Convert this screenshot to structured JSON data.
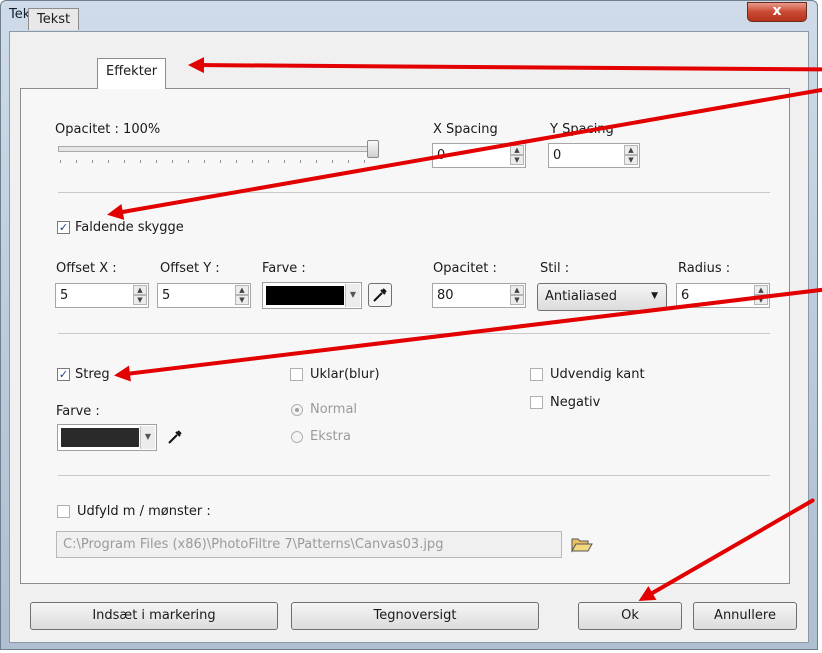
{
  "window": {
    "title": "Tekst",
    "close_label": "x"
  },
  "tabs": [
    {
      "label": "Tekst"
    },
    {
      "label": "Effekter"
    }
  ],
  "opacity": {
    "label": "Opacitet : 100%"
  },
  "spacing": {
    "x_label": "X Spacing",
    "x_value": "0",
    "y_label": "Y Spacing",
    "y_value": "0"
  },
  "shadow": {
    "check_label": "Faldende skygge",
    "offset_x_label": "Offset X :",
    "offset_x_value": "5",
    "offset_y_label": "Offset Y :",
    "offset_y_value": "5",
    "color_label": "Farve :",
    "opacity_label": "Opacitet :",
    "opacity_value": "80",
    "style_label": "Stil :",
    "style_value": "Antialiased",
    "radius_label": "Radius :",
    "radius_value": "6"
  },
  "stroke": {
    "check_label": "Streg",
    "color_label": "Farve :",
    "blur_label": "Uklar(blur)",
    "normal_label": "Normal",
    "extra_label": "Ekstra",
    "outer_label": "Udvendig kant",
    "negative_label": "Negativ"
  },
  "fill": {
    "check_label": "Udfyld m / mønster :",
    "path_value": "C:\\Program Files (x86)\\PhotoFiltre 7\\Patterns\\Canvas03.jpg"
  },
  "buttons": {
    "insert": "Indsæt i markering",
    "charmap": "Tegnoversigt",
    "ok": "Ok",
    "cancel": "Annullere"
  },
  "colors": {
    "shadow_color": "#000000",
    "stroke_color": "#2a2a2a",
    "annotation": "#e20000"
  }
}
